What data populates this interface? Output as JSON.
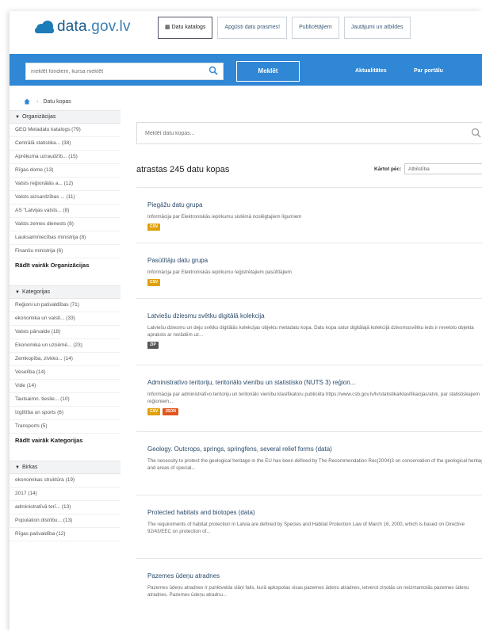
{
  "header": {
    "logo_main": "data",
    "logo_domain": ".gov.lv",
    "nav": [
      "Datu katalogs",
      "Apgūsti datu prasmes!",
      "Publicētājiem",
      "Jautājumi un atbildes"
    ]
  },
  "search": {
    "placeholder": "meklēt fondiem, kursa meklēt",
    "button": "Meklēt",
    "links": [
      "Aktualitātes",
      "Par portālu"
    ]
  },
  "breadcrumb": {
    "current": "Datu kopas"
  },
  "sidebar": {
    "facets": [
      {
        "title": "Organizācijas",
        "items": [
          "ĢEO Metadatu katalogs (79)",
          "Centrālā statistika... (38)",
          "Aprēķuma uzraudzīb... (15)",
          "Rīgas dome (13)",
          "Valsts reģionālās a... (12)",
          "Valsts aizsardzības ... (11)",
          "AS \"Latvijas valsts... (8)",
          "Valsts zemes dienests (8)",
          "Lauksaimniecības ministrija (8)",
          "Finanšu ministrija (6)"
        ],
        "more": "Rādīt vairāk Organizācijas"
      },
      {
        "title": "Kategorijas",
        "items": [
          "Reģioni un pašvaldības (71)",
          "ekonomika un valsti... (33)",
          "Valsts pārvalde (18)",
          "Ekonomika un uzņēmē... (23)",
          "Zemkopība, zivkko... (14)",
          "Veselība (14)",
          "Vide (14)",
          "Tautsaimn. tieslie... (10)",
          "Izglītība un sports (6)",
          "Transports (5)"
        ],
        "more": "Rādīt vairāk Kategorijas"
      },
      {
        "title": "Birkas",
        "items": [
          "ekonomikas struktūra (19)",
          "2017 (14)",
          "administratīvā terī... (13)",
          "Population distribu... (13)",
          "Rīgas pašvaldība (12)"
        ],
        "more": ""
      }
    ]
  },
  "main": {
    "search_placeholder": "Meklēt datu kopas...",
    "count": "atrastas 245 datu kopas",
    "sort_label": "Kārtot pēc:",
    "sort_value": "Atbilstība",
    "results": [
      {
        "title": "Piegāžu datu grupa",
        "desc": "Informācija par Elektroniskās iepirkumu sistēmā noslēgtajiem līgumiem",
        "badges": [
          {
            "label": "CSV",
            "color": "#e0a00a"
          }
        ]
      },
      {
        "title": "Pasūtītāju datu grupa",
        "desc": "Informācija par Elektroniskās iepirkumu reģistrētajiem pasūtītājiem",
        "badges": [
          {
            "label": "CSV",
            "color": "#e0a00a"
          }
        ]
      },
      {
        "title": "Latviešu dziesmu svētku digitālā kolekcija",
        "desc": "Latviešu dziesmu un deju svētku digitālās kolekcijas objektu metadatu kopa. Datu kopa satur digitālajā kolekcijā dziesmusvētku ieds ir reveloto objekta apraksts ar norādēm uz...",
        "badges": [
          {
            "label": "ZIP",
            "color": "#555555"
          }
        ]
      },
      {
        "title": "Administratīvo teritoriju, teritoriālo vienību un statistisko (NUTS 3) reģion...",
        "desc": "Informācija par administratīvo teritoriju un teritoriālo vienību klasifikatoru publicēta https://www.csb.gov.lv/lv/statistika/klasifikacijas/atvk, par statistiskajiem reģioniem...",
        "badges": [
          {
            "label": "CSV",
            "color": "#e0a00a"
          },
          {
            "label": "JSON",
            "color": "#e0551d"
          }
        ]
      },
      {
        "title": "Geology. Outcrops, springs, springfens, several relief forms (data)",
        "desc": "The necessity to protect the geological heritage in the EU has been defined by The Recommendation Rec(2004)3 on conservation of the geological heritage and areas of special...",
        "badges": []
      },
      {
        "title": "Protected habitats and biotopes (data)",
        "desc": "The requirements of habitat protection in Latvia are defined by Species and Habitat Protection Law of March 16, 2000, which is based on Directive 92/43/EEC on protection of...",
        "badges": []
      },
      {
        "title": "Pazemes ūdeņu atradnes",
        "desc": "Pazemes ūdeņu atradnes ir punktveida slāņi fails, kurā apkopotas visas pazemes ūdeņu atradnes, ietverot ziņotās un neizmantotās pazemes ūdeņu atradnes. Pazemes ūdeņu atradnu...",
        "badges": []
      }
    ]
  }
}
